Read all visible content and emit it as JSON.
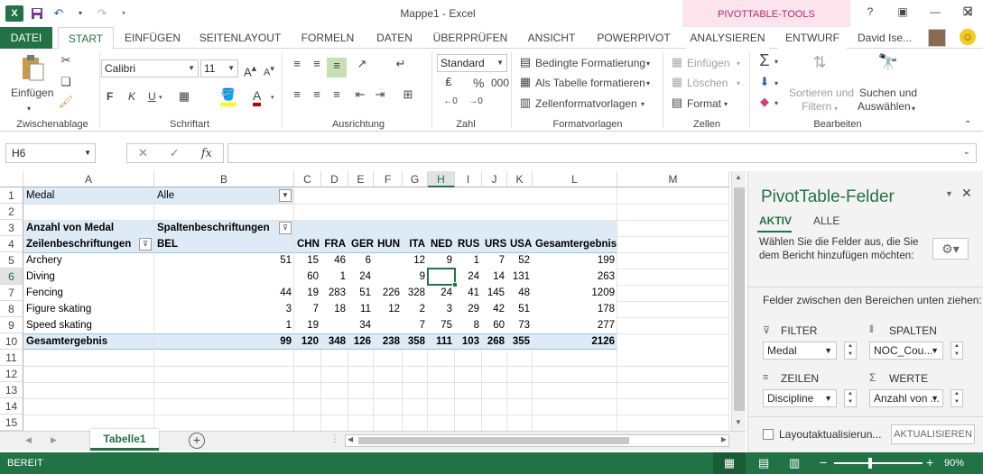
{
  "window": {
    "title": "Mappe1 - Excel",
    "context_tab_group": "PIVOTTABLE-TOOLS",
    "help": "?",
    "user": "David Ise..."
  },
  "tabs": [
    {
      "label": "DATEI"
    },
    {
      "label": "START"
    },
    {
      "label": "EINFÜGEN"
    },
    {
      "label": "SEITENLAYOUT"
    },
    {
      "label": "FORMELN"
    },
    {
      "label": "DATEN"
    },
    {
      "label": "ÜBERPRÜFEN"
    },
    {
      "label": "ANSICHT"
    },
    {
      "label": "POWERPIVOT"
    },
    {
      "label": "ANALYSIEREN"
    },
    {
      "label": "ENTWURF"
    }
  ],
  "ribbon": {
    "clipboard": {
      "paste": "Einfügen",
      "group": "Zwischenablage"
    },
    "font": {
      "name": "Calibri",
      "size": "11",
      "bold": "F",
      "italic": "K",
      "underline": "U",
      "group": "Schriftart"
    },
    "alignment": {
      "group": "Ausrichtung"
    },
    "number": {
      "format": "Standard",
      "percent": "%",
      "thousands": "000",
      "group": "Zahl"
    },
    "styles": {
      "cond": "Bedingte Formatierung",
      "table": "Als Tabelle formatieren",
      "cell": "Zellenformatvorlagen",
      "group": "Formatvorlagen"
    },
    "cells": {
      "insert": "Einfügen",
      "delete": "Löschen",
      "format": "Format",
      "group": "Zellen"
    },
    "editing": {
      "sort_l1": "Sortieren und",
      "sort_l2": "Filtern",
      "find_l1": "Suchen und",
      "find_l2": "Auswählen",
      "group": "Bearbeiten"
    }
  },
  "formula_bar": {
    "name_box": "H6",
    "fx": "fx"
  },
  "columns": [
    {
      "id": "A"
    },
    {
      "id": "B"
    },
    {
      "id": "C"
    },
    {
      "id": "D"
    },
    {
      "id": "E"
    },
    {
      "id": "F"
    },
    {
      "id": "G"
    },
    {
      "id": "H"
    },
    {
      "id": "I"
    },
    {
      "id": "J"
    },
    {
      "id": "K"
    },
    {
      "id": "L"
    },
    {
      "id": "M"
    }
  ],
  "rows": [
    "1",
    "2",
    "3",
    "4",
    "5",
    "6",
    "7",
    "8",
    "9",
    "10",
    "11",
    "12",
    "13",
    "14",
    "15"
  ],
  "pivot": {
    "filter_label": "Medal",
    "filter_value": "Alle",
    "values_label": "Anzahl von Medal",
    "columns_label": "Spaltenbeschriftungen",
    "rows_label": "Zeilenbeschriftungen",
    "col_headers": [
      "BEL",
      "CHN",
      "FRA",
      "GER",
      "HUN",
      "ITA",
      "NED",
      "RUS",
      "URS",
      "USA",
      "Gesamtergebnis"
    ],
    "data_rows": [
      {
        "label": "Archery",
        "values": [
          "51",
          "15",
          "46",
          "6",
          "",
          "12",
          "9",
          "1",
          "7",
          "52",
          "199"
        ]
      },
      {
        "label": "Diving",
        "values": [
          "",
          "60",
          "1",
          "24",
          "",
          "9",
          "",
          "24",
          "14",
          "131",
          "263"
        ]
      },
      {
        "label": "Fencing",
        "values": [
          "44",
          "19",
          "283",
          "51",
          "226",
          "328",
          "24",
          "41",
          "145",
          "48",
          "1209"
        ]
      },
      {
        "label": "Figure skating",
        "values": [
          "3",
          "7",
          "18",
          "11",
          "12",
          "2",
          "3",
          "29",
          "42",
          "51",
          "178"
        ]
      },
      {
        "label": "Speed skating",
        "values": [
          "1",
          "19",
          "",
          "34",
          "",
          "7",
          "75",
          "8",
          "60",
          "73",
          "277"
        ]
      }
    ],
    "total_row": {
      "label": "Gesamtergebnis",
      "values": [
        "99",
        "120",
        "348",
        "126",
        "238",
        "358",
        "111",
        "103",
        "268",
        "355",
        "2126"
      ]
    }
  },
  "sheet_tabs": [
    {
      "label": "Tabelle1"
    }
  ],
  "status": {
    "ready": "BEREIT",
    "zoom": "90%"
  },
  "panel": {
    "title": "PivotTable-Felder",
    "tab_active": "AKTIV",
    "tab_all": "ALLE",
    "description": "Wählen Sie die Felder aus, die Sie dem Bericht hinzufügen möchten:",
    "areas_hint": "Felder zwischen den Bereichen unten ziehen:",
    "filter_label": "FILTER",
    "columns_label": "SPALTEN",
    "rows_label": "ZEILEN",
    "values_label": "WERTE",
    "filter_field": "Medal",
    "columns_field": "NOC_Cou...",
    "rows_field": "Discipline",
    "values_field": "Anzahl von ...",
    "defer_label": "Layoutaktualisierun...",
    "update_button": "AKTUALISIEREN"
  }
}
